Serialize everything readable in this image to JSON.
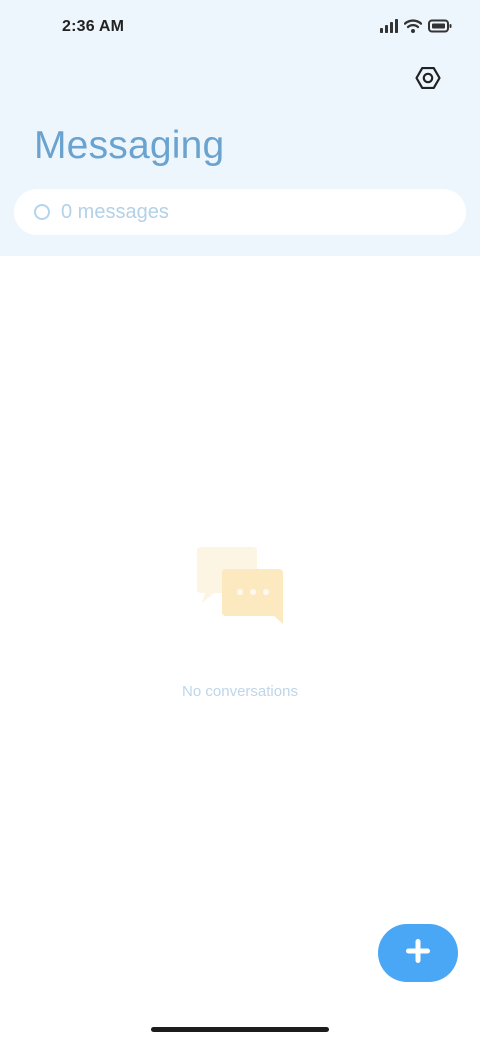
{
  "status_bar": {
    "time": "2:36 AM",
    "icons": [
      "signal-icon",
      "wifi-icon",
      "battery-icon"
    ]
  },
  "header": {
    "title": "Messaging",
    "settings_icon": "settings-icon"
  },
  "search": {
    "text": "0 messages"
  },
  "empty_state": {
    "illustration": "chat-bubbles-icon",
    "message": "No conversations"
  },
  "fab": {
    "icon": "plus-icon"
  },
  "colors": {
    "header_bg": "#eef6fd",
    "title": "#6aa3cf",
    "accent": "#4aa7f5",
    "empty_text": "#bdd6ea",
    "bubble_back": "#fdf4e0",
    "bubble_front": "#fde8bd"
  }
}
